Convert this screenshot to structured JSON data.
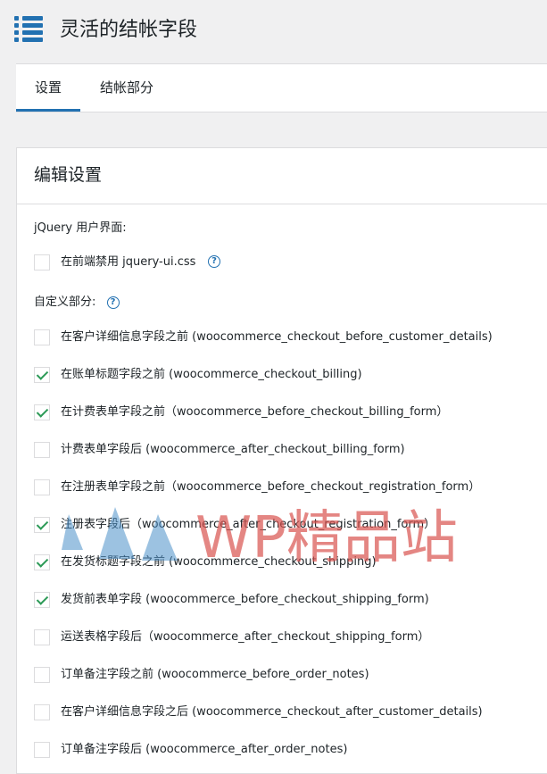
{
  "header": {
    "title": "灵活的结帐字段"
  },
  "tabs": [
    {
      "label": "设置",
      "active": true
    },
    {
      "label": "结帐部分",
      "active": false
    }
  ],
  "panel": {
    "title": "编辑设置",
    "jquery_label": "jQuery 用户界面:",
    "jquery_option": {
      "label": "在前端禁用 jquery-ui.css",
      "checked": false
    },
    "custom_label": "自定义部分:",
    "options": [
      {
        "label": "在客户详细信息字段之前 (woocommerce_checkout_before_customer_details)",
        "checked": false
      },
      {
        "label": "在账单标题字段之前 (woocommerce_checkout_billing)",
        "checked": true
      },
      {
        "label": "在计费表单字段之前（woocommerce_before_checkout_billing_form）",
        "checked": true
      },
      {
        "label": "计费表单字段后 (woocommerce_after_checkout_billing_form)",
        "checked": false
      },
      {
        "label": "在注册表单字段之前（woocommerce_before_checkout_registration_form）",
        "checked": false
      },
      {
        "label": "注册表字段后（woocommerce_after_checkout_registration_form）",
        "checked": true
      },
      {
        "label": "在发货标题字段之前 (woocommerce_checkout_shipping)",
        "checked": true
      },
      {
        "label": "发货前表单字段 (woocommerce_before_checkout_shipping_form)",
        "checked": true
      },
      {
        "label": "运送表格字段后（woocommerce_after_checkout_shipping_form）",
        "checked": false
      },
      {
        "label": "订单备注字段之前 (woocommerce_before_order_notes)",
        "checked": false
      },
      {
        "label": "在客户详细信息字段之后 (woocommerce_checkout_after_customer_details)",
        "checked": false
      },
      {
        "label": "订单备注字段后 (woocommerce_after_order_notes)",
        "checked": false
      }
    ]
  },
  "watermark": {
    "text": "WP精品站"
  },
  "icons": {
    "menu": "list-icon",
    "help": "question-circle-icon",
    "check": "checkmark-icon"
  },
  "colors": {
    "accent": "#2271b1",
    "check": "#2c9a57",
    "watermark": "#d9534f"
  }
}
